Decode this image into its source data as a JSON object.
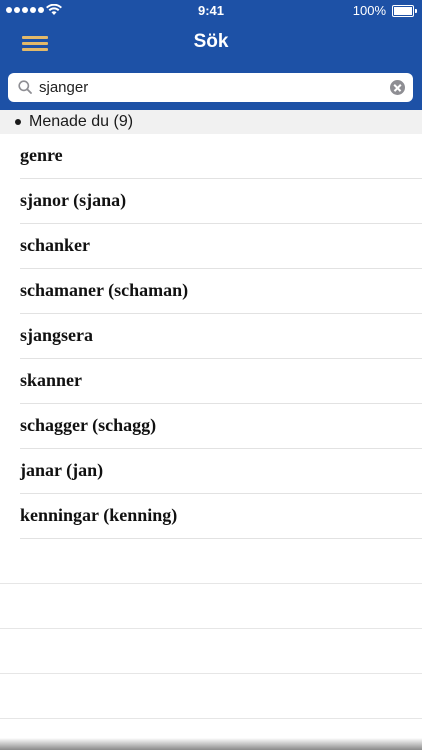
{
  "status_bar": {
    "time": "9:41",
    "battery": "100%"
  },
  "nav": {
    "title": "Sök",
    "menu_icon": "hamburger-menu-icon",
    "menu_color": "#e2b96a",
    "background": "#1d51a6"
  },
  "search": {
    "value": "sjanger",
    "icon": "search-icon",
    "clear_icon": "clear-icon"
  },
  "section": {
    "label": "Menade du (9)"
  },
  "results": [
    "genre",
    "sjanor (sjana)",
    "schanker",
    "schamaner (schaman)",
    "sjangsera",
    "skanner",
    "schagger (schagg)",
    "janar (jan)",
    "kenningar (kenning)"
  ]
}
